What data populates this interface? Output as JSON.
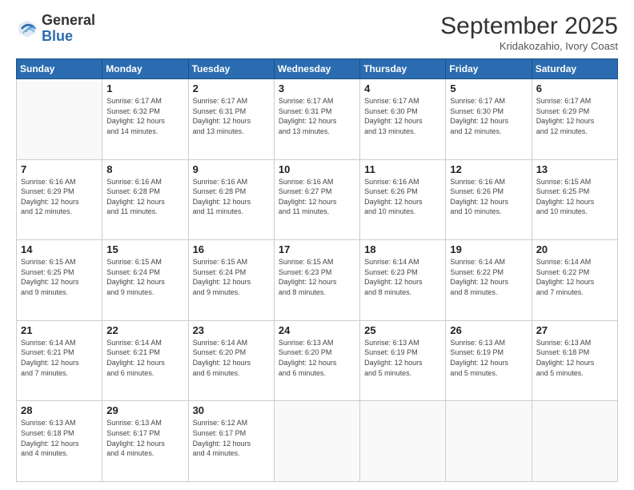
{
  "logo": {
    "general": "General",
    "blue": "Blue"
  },
  "header": {
    "month": "September 2025",
    "location": "Kridakozahio, Ivory Coast"
  },
  "weekdays": [
    "Sunday",
    "Monday",
    "Tuesday",
    "Wednesday",
    "Thursday",
    "Friday",
    "Saturday"
  ],
  "weeks": [
    [
      {
        "day": "",
        "info": ""
      },
      {
        "day": "1",
        "info": "Sunrise: 6:17 AM\nSunset: 6:32 PM\nDaylight: 12 hours\nand 14 minutes."
      },
      {
        "day": "2",
        "info": "Sunrise: 6:17 AM\nSunset: 6:31 PM\nDaylight: 12 hours\nand 13 minutes."
      },
      {
        "day": "3",
        "info": "Sunrise: 6:17 AM\nSunset: 6:31 PM\nDaylight: 12 hours\nand 13 minutes."
      },
      {
        "day": "4",
        "info": "Sunrise: 6:17 AM\nSunset: 6:30 PM\nDaylight: 12 hours\nand 13 minutes."
      },
      {
        "day": "5",
        "info": "Sunrise: 6:17 AM\nSunset: 6:30 PM\nDaylight: 12 hours\nand 12 minutes."
      },
      {
        "day": "6",
        "info": "Sunrise: 6:17 AM\nSunset: 6:29 PM\nDaylight: 12 hours\nand 12 minutes."
      }
    ],
    [
      {
        "day": "7",
        "info": "Sunrise: 6:16 AM\nSunset: 6:29 PM\nDaylight: 12 hours\nand 12 minutes."
      },
      {
        "day": "8",
        "info": "Sunrise: 6:16 AM\nSunset: 6:28 PM\nDaylight: 12 hours\nand 11 minutes."
      },
      {
        "day": "9",
        "info": "Sunrise: 6:16 AM\nSunset: 6:28 PM\nDaylight: 12 hours\nand 11 minutes."
      },
      {
        "day": "10",
        "info": "Sunrise: 6:16 AM\nSunset: 6:27 PM\nDaylight: 12 hours\nand 11 minutes."
      },
      {
        "day": "11",
        "info": "Sunrise: 6:16 AM\nSunset: 6:26 PM\nDaylight: 12 hours\nand 10 minutes."
      },
      {
        "day": "12",
        "info": "Sunrise: 6:16 AM\nSunset: 6:26 PM\nDaylight: 12 hours\nand 10 minutes."
      },
      {
        "day": "13",
        "info": "Sunrise: 6:15 AM\nSunset: 6:25 PM\nDaylight: 12 hours\nand 10 minutes."
      }
    ],
    [
      {
        "day": "14",
        "info": "Sunrise: 6:15 AM\nSunset: 6:25 PM\nDaylight: 12 hours\nand 9 minutes."
      },
      {
        "day": "15",
        "info": "Sunrise: 6:15 AM\nSunset: 6:24 PM\nDaylight: 12 hours\nand 9 minutes."
      },
      {
        "day": "16",
        "info": "Sunrise: 6:15 AM\nSunset: 6:24 PM\nDaylight: 12 hours\nand 9 minutes."
      },
      {
        "day": "17",
        "info": "Sunrise: 6:15 AM\nSunset: 6:23 PM\nDaylight: 12 hours\nand 8 minutes."
      },
      {
        "day": "18",
        "info": "Sunrise: 6:14 AM\nSunset: 6:23 PM\nDaylight: 12 hours\nand 8 minutes."
      },
      {
        "day": "19",
        "info": "Sunrise: 6:14 AM\nSunset: 6:22 PM\nDaylight: 12 hours\nand 8 minutes."
      },
      {
        "day": "20",
        "info": "Sunrise: 6:14 AM\nSunset: 6:22 PM\nDaylight: 12 hours\nand 7 minutes."
      }
    ],
    [
      {
        "day": "21",
        "info": "Sunrise: 6:14 AM\nSunset: 6:21 PM\nDaylight: 12 hours\nand 7 minutes."
      },
      {
        "day": "22",
        "info": "Sunrise: 6:14 AM\nSunset: 6:21 PM\nDaylight: 12 hours\nand 6 minutes."
      },
      {
        "day": "23",
        "info": "Sunrise: 6:14 AM\nSunset: 6:20 PM\nDaylight: 12 hours\nand 6 minutes."
      },
      {
        "day": "24",
        "info": "Sunrise: 6:13 AM\nSunset: 6:20 PM\nDaylight: 12 hours\nand 6 minutes."
      },
      {
        "day": "25",
        "info": "Sunrise: 6:13 AM\nSunset: 6:19 PM\nDaylight: 12 hours\nand 5 minutes."
      },
      {
        "day": "26",
        "info": "Sunrise: 6:13 AM\nSunset: 6:19 PM\nDaylight: 12 hours\nand 5 minutes."
      },
      {
        "day": "27",
        "info": "Sunrise: 6:13 AM\nSunset: 6:18 PM\nDaylight: 12 hours\nand 5 minutes."
      }
    ],
    [
      {
        "day": "28",
        "info": "Sunrise: 6:13 AM\nSunset: 6:18 PM\nDaylight: 12 hours\nand 4 minutes."
      },
      {
        "day": "29",
        "info": "Sunrise: 6:13 AM\nSunset: 6:17 PM\nDaylight: 12 hours\nand 4 minutes."
      },
      {
        "day": "30",
        "info": "Sunrise: 6:12 AM\nSunset: 6:17 PM\nDaylight: 12 hours\nand 4 minutes."
      },
      {
        "day": "",
        "info": ""
      },
      {
        "day": "",
        "info": ""
      },
      {
        "day": "",
        "info": ""
      },
      {
        "day": "",
        "info": ""
      }
    ]
  ]
}
